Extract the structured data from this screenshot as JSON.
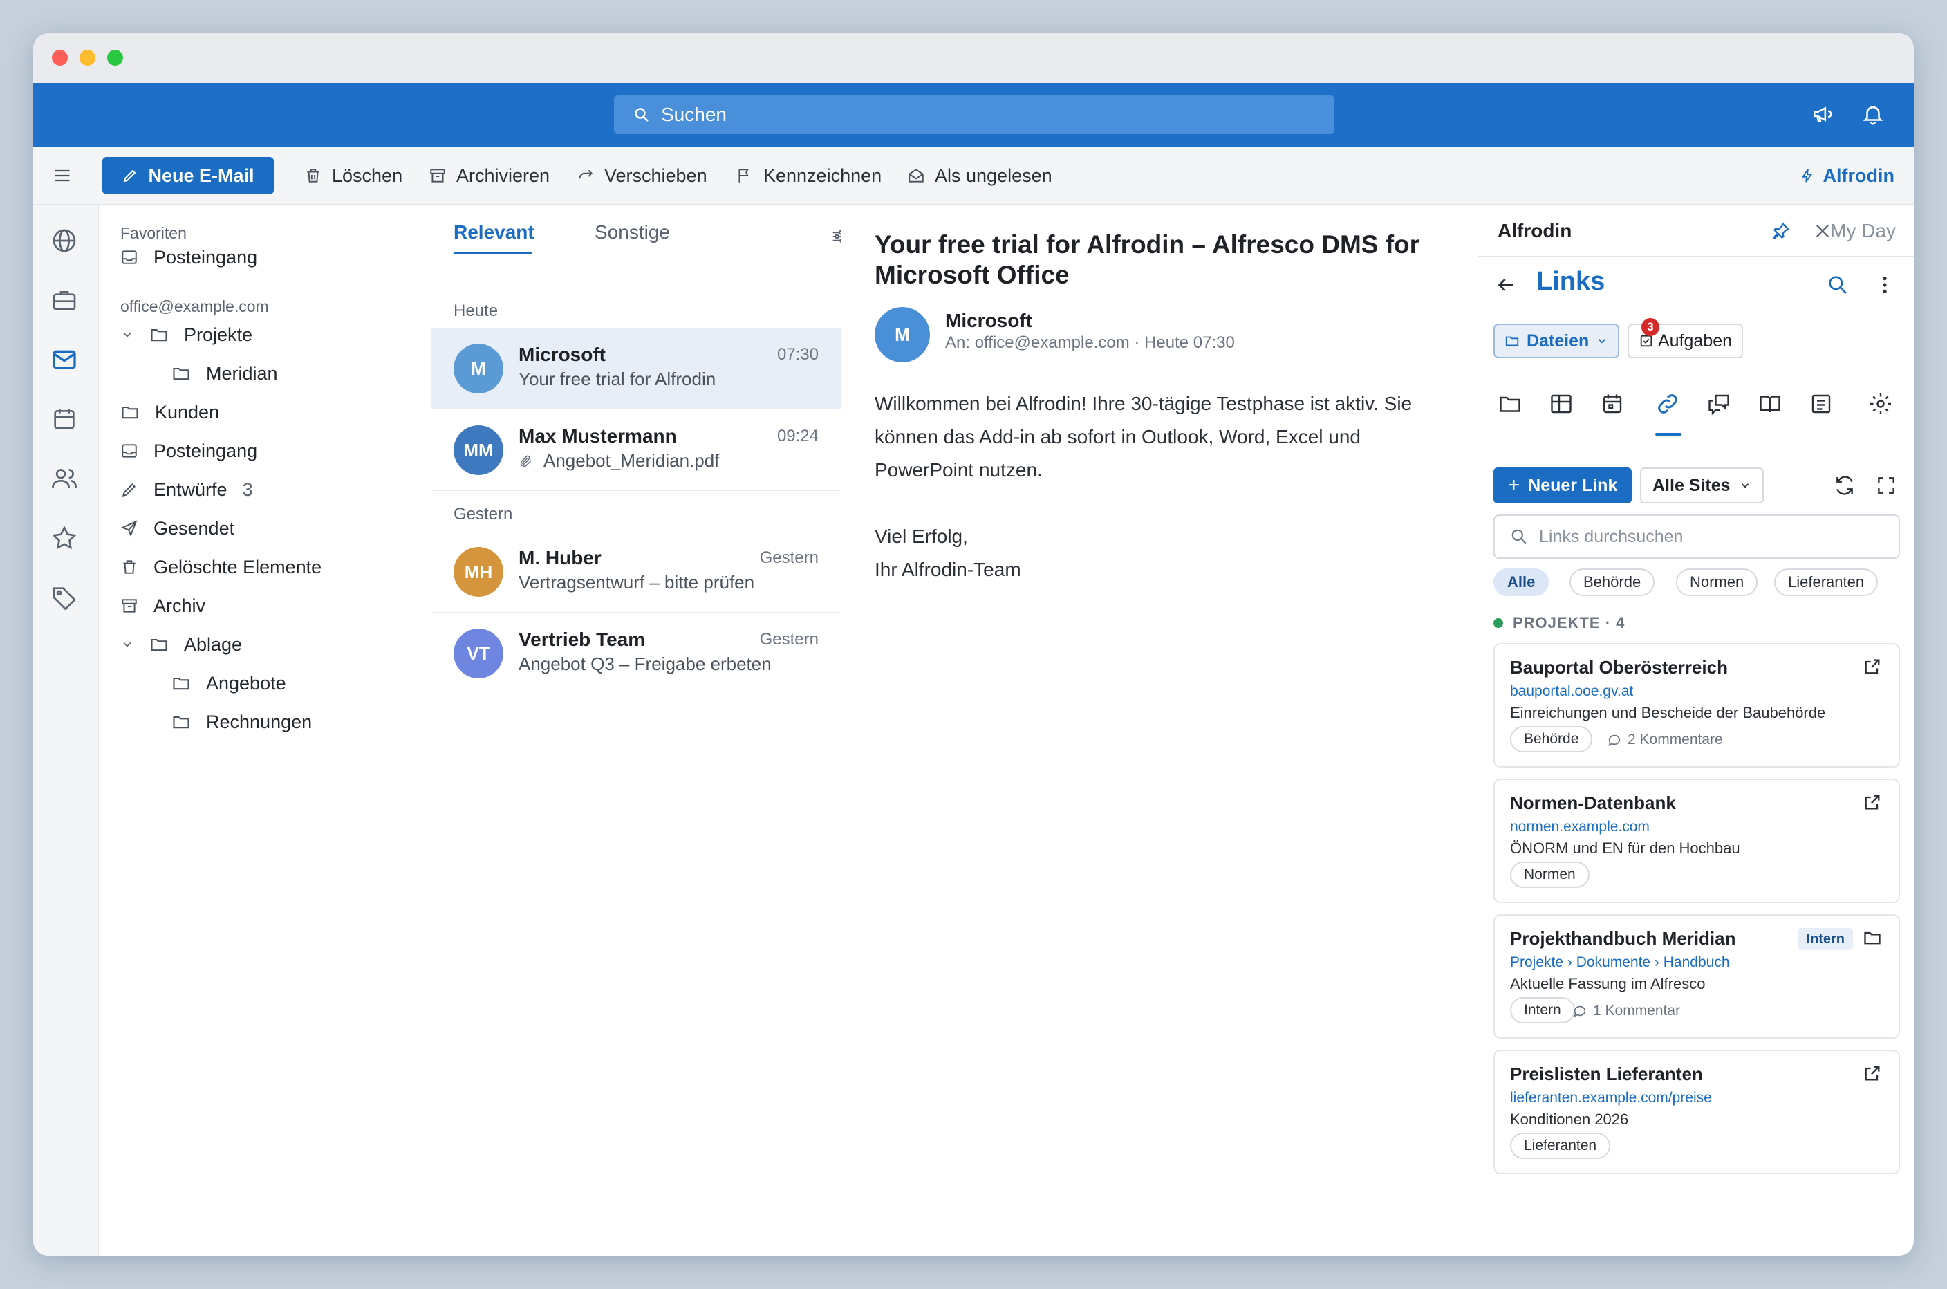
{
  "search": {
    "placeholder": "Suchen"
  },
  "toolbar": {
    "new_mail": "Neue E-Mail",
    "delete": "Löschen",
    "archive": "Archivieren",
    "move": "Verschieben",
    "flag": "Kennzeichnen",
    "mark_unread": "Als ungelesen",
    "addin": "Alfrodin"
  },
  "folders": {
    "favorites_label": "Favoriten",
    "fav_inbox": "Posteingang",
    "account": "office@example.com",
    "projekte": "Projekte",
    "meridian": "Meridian",
    "kunden": "Kunden",
    "inbox": "Posteingang",
    "drafts": "Entwürfe",
    "drafts_count": "3",
    "sent": "Gesendet",
    "deleted": "Gelöschte Elemente",
    "archive": "Archiv",
    "ablage": "Ablage",
    "angebote": "Angebote",
    "rechnungen": "Rechnungen"
  },
  "maillist": {
    "tab_relevant": "Relevant",
    "tab_other": "Sonstige",
    "group_today": "Heute",
    "group_yesterday": "Gestern",
    "messages": [
      {
        "initials": "M",
        "sender": "Microsoft",
        "subject": "Your free trial for Alfrodin",
        "time": "07:30",
        "color": "#5b9bd5"
      },
      {
        "initials": "MM",
        "sender": "Max Mustermann",
        "subject": "Angebot_Meridian.pdf",
        "time": "09:24",
        "color": "#3f7ac0"
      },
      {
        "initials": "MH",
        "sender": "M. Huber",
        "subject": "Vertragsentwurf – bitte prüfen",
        "time": "Gestern",
        "color": "#d4953c"
      },
      {
        "initials": "VT",
        "sender": "Vertrieb Team",
        "subject": "Angebot Q3 – Freigabe erbeten",
        "time": "Gestern",
        "color": "#6f86e0"
      }
    ]
  },
  "reading": {
    "title": "Your free trial for Alfrodin – Alfresco DMS for Microsoft Office",
    "initials": "M",
    "sender": "Microsoft",
    "meta": "An: office@example.com  ·  Heute 07:30",
    "para1": "Willkommen bei Alfrodin! Ihre 30-tägige Testphase ist aktiv. Sie können das Add-in ab sofort in Outlook, Word, Excel und PowerPoint nutzen.",
    "greet1": "Viel Erfolg,",
    "greet2": "Ihr Alfrodin-Team"
  },
  "panel": {
    "title": "Alfrodin",
    "myday": "My Day",
    "heading": "Links",
    "files_btn": "Dateien",
    "tasks_btn": "Aufgaben",
    "tasks_badge": "3",
    "new_link": "Neuer Link",
    "all_sites": "Alle Sites",
    "search_placeholder": "Links durchsuchen",
    "chips": [
      "Alle",
      "Behörde",
      "Normen",
      "Lieferanten"
    ],
    "section": "PROJEKTE · 4",
    "cards": [
      {
        "title": "Bauportal Oberösterreich",
        "url": "bauportal.ooe.gv.at",
        "desc": "Einreichungen und Bescheide der Baubehörde",
        "tag": "Behörde",
        "comments": "2 Kommentare"
      },
      {
        "title": "Normen-Datenbank",
        "url": "normen.example.com",
        "desc": "ÖNORM und EN für den Hochbau",
        "tag": "Normen",
        "comments": ""
      },
      {
        "title": "Projekthandbuch Meridian",
        "url": "Projekte › Dokumente › Handbuch",
        "desc": "Aktuelle Fassung im Alfresco",
        "tag": "Intern",
        "comments": "1 Kommentar",
        "badge": "Intern"
      },
      {
        "title": "Preislisten Lieferanten",
        "url": "lieferanten.example.com/preise",
        "desc": "Konditionen 2026",
        "tag": "Lieferanten",
        "comments": ""
      }
    ]
  },
  "colors": {
    "brand": "#1e6fc7",
    "accent": "#1a6dc3"
  }
}
